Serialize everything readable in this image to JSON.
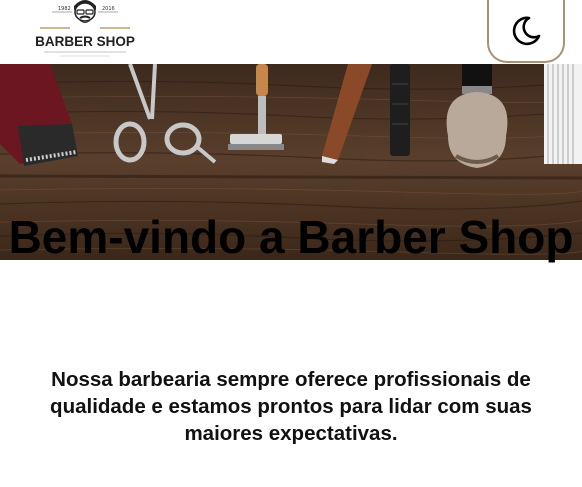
{
  "header": {
    "logo": {
      "year_left": "1982",
      "year_right": "2016",
      "name": "BARBER SHOP"
    },
    "theme_toggle_icon": "moon-icon"
  },
  "hero": {
    "image": "barber-tools-on-wooden-table",
    "title": "Bem-vindo a Barber Shop",
    "intro": "Nossa barbearia sempre oferece profissionais de qualidade e estamos prontos para lidar com suas maiores expectativas."
  },
  "colors": {
    "wood": "#4a3426",
    "toggle_border": "#a89276",
    "text": "#000000"
  }
}
